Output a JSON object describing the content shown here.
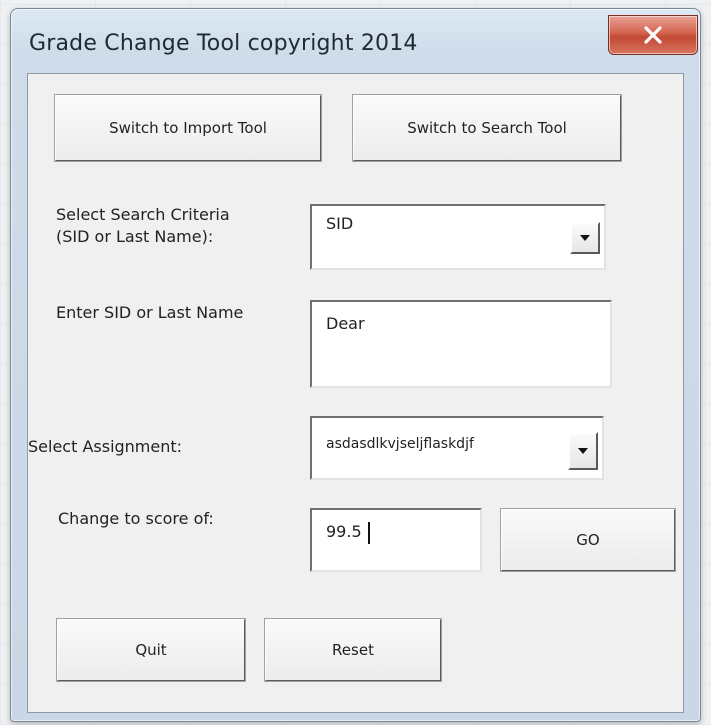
{
  "window": {
    "title": "Grade Change Tool copyright 2014",
    "close_glyph": "X"
  },
  "buttons": {
    "import_tool": "Switch to Import Tool",
    "search_tool": "Switch to Search Tool",
    "go": "GO",
    "quit": "Quit",
    "reset": "Reset"
  },
  "form": {
    "criteria_label_line1": "Select Search Criteria",
    "criteria_label_line2": "(SID or Last Name):",
    "criteria_value": "SID",
    "name_label": "Enter SID or Last Name",
    "name_value": "Dear",
    "assignment_label": "Select Assignment:",
    "assignment_value": "asdasdlkvjseljflaskdjf",
    "score_label": "Change to score of:",
    "score_value": "99.5"
  },
  "icons": {
    "close": "close-icon",
    "dropdown": "dropdown-arrow-icon"
  },
  "colors": {
    "close_button": "#c24a35",
    "dialog_frame": "#cad7e6",
    "dialog_body": "#f0f0f0"
  }
}
